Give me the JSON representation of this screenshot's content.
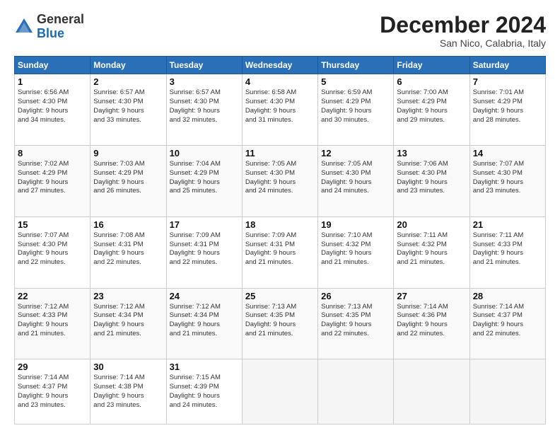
{
  "logo": {
    "general": "General",
    "blue": "Blue"
  },
  "header": {
    "month": "December 2024",
    "location": "San Nico, Calabria, Italy"
  },
  "weekdays": [
    "Sunday",
    "Monday",
    "Tuesday",
    "Wednesday",
    "Thursday",
    "Friday",
    "Saturday"
  ],
  "weeks": [
    [
      {
        "day": "1",
        "info": "Sunrise: 6:56 AM\nSunset: 4:30 PM\nDaylight: 9 hours\nand 34 minutes."
      },
      {
        "day": "2",
        "info": "Sunrise: 6:57 AM\nSunset: 4:30 PM\nDaylight: 9 hours\nand 33 minutes."
      },
      {
        "day": "3",
        "info": "Sunrise: 6:57 AM\nSunset: 4:30 PM\nDaylight: 9 hours\nand 32 minutes."
      },
      {
        "day": "4",
        "info": "Sunrise: 6:58 AM\nSunset: 4:30 PM\nDaylight: 9 hours\nand 31 minutes."
      },
      {
        "day": "5",
        "info": "Sunrise: 6:59 AM\nSunset: 4:29 PM\nDaylight: 9 hours\nand 30 minutes."
      },
      {
        "day": "6",
        "info": "Sunrise: 7:00 AM\nSunset: 4:29 PM\nDaylight: 9 hours\nand 29 minutes."
      },
      {
        "day": "7",
        "info": "Sunrise: 7:01 AM\nSunset: 4:29 PM\nDaylight: 9 hours\nand 28 minutes."
      }
    ],
    [
      {
        "day": "8",
        "info": "Sunrise: 7:02 AM\nSunset: 4:29 PM\nDaylight: 9 hours\nand 27 minutes."
      },
      {
        "day": "9",
        "info": "Sunrise: 7:03 AM\nSunset: 4:29 PM\nDaylight: 9 hours\nand 26 minutes."
      },
      {
        "day": "10",
        "info": "Sunrise: 7:04 AM\nSunset: 4:29 PM\nDaylight: 9 hours\nand 25 minutes."
      },
      {
        "day": "11",
        "info": "Sunrise: 7:05 AM\nSunset: 4:30 PM\nDaylight: 9 hours\nand 24 minutes."
      },
      {
        "day": "12",
        "info": "Sunrise: 7:05 AM\nSunset: 4:30 PM\nDaylight: 9 hours\nand 24 minutes."
      },
      {
        "day": "13",
        "info": "Sunrise: 7:06 AM\nSunset: 4:30 PM\nDaylight: 9 hours\nand 23 minutes."
      },
      {
        "day": "14",
        "info": "Sunrise: 7:07 AM\nSunset: 4:30 PM\nDaylight: 9 hours\nand 23 minutes."
      }
    ],
    [
      {
        "day": "15",
        "info": "Sunrise: 7:07 AM\nSunset: 4:30 PM\nDaylight: 9 hours\nand 22 minutes."
      },
      {
        "day": "16",
        "info": "Sunrise: 7:08 AM\nSunset: 4:31 PM\nDaylight: 9 hours\nand 22 minutes."
      },
      {
        "day": "17",
        "info": "Sunrise: 7:09 AM\nSunset: 4:31 PM\nDaylight: 9 hours\nand 22 minutes."
      },
      {
        "day": "18",
        "info": "Sunrise: 7:09 AM\nSunset: 4:31 PM\nDaylight: 9 hours\nand 21 minutes."
      },
      {
        "day": "19",
        "info": "Sunrise: 7:10 AM\nSunset: 4:32 PM\nDaylight: 9 hours\nand 21 minutes."
      },
      {
        "day": "20",
        "info": "Sunrise: 7:11 AM\nSunset: 4:32 PM\nDaylight: 9 hours\nand 21 minutes."
      },
      {
        "day": "21",
        "info": "Sunrise: 7:11 AM\nSunset: 4:33 PM\nDaylight: 9 hours\nand 21 minutes."
      }
    ],
    [
      {
        "day": "22",
        "info": "Sunrise: 7:12 AM\nSunset: 4:33 PM\nDaylight: 9 hours\nand 21 minutes."
      },
      {
        "day": "23",
        "info": "Sunrise: 7:12 AM\nSunset: 4:34 PM\nDaylight: 9 hours\nand 21 minutes."
      },
      {
        "day": "24",
        "info": "Sunrise: 7:12 AM\nSunset: 4:34 PM\nDaylight: 9 hours\nand 21 minutes."
      },
      {
        "day": "25",
        "info": "Sunrise: 7:13 AM\nSunset: 4:35 PM\nDaylight: 9 hours\nand 21 minutes."
      },
      {
        "day": "26",
        "info": "Sunrise: 7:13 AM\nSunset: 4:35 PM\nDaylight: 9 hours\nand 22 minutes."
      },
      {
        "day": "27",
        "info": "Sunrise: 7:14 AM\nSunset: 4:36 PM\nDaylight: 9 hours\nand 22 minutes."
      },
      {
        "day": "28",
        "info": "Sunrise: 7:14 AM\nSunset: 4:37 PM\nDaylight: 9 hours\nand 22 minutes."
      }
    ],
    [
      {
        "day": "29",
        "info": "Sunrise: 7:14 AM\nSunset: 4:37 PM\nDaylight: 9 hours\nand 23 minutes."
      },
      {
        "day": "30",
        "info": "Sunrise: 7:14 AM\nSunset: 4:38 PM\nDaylight: 9 hours\nand 23 minutes."
      },
      {
        "day": "31",
        "info": "Sunrise: 7:15 AM\nSunset: 4:39 PM\nDaylight: 9 hours\nand 24 minutes."
      },
      {
        "day": "",
        "info": ""
      },
      {
        "day": "",
        "info": ""
      },
      {
        "day": "",
        "info": ""
      },
      {
        "day": "",
        "info": ""
      }
    ]
  ]
}
